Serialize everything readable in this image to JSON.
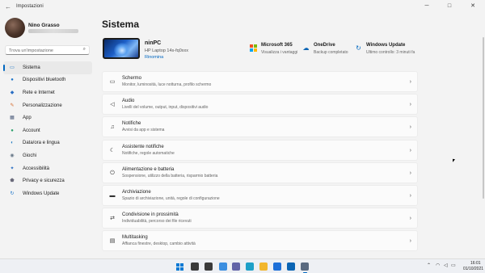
{
  "app": {
    "title": "Impostazioni",
    "back_glyph": "←",
    "minimize_glyph": "─",
    "maximize_glyph": "□",
    "close_glyph": "✕"
  },
  "profile": {
    "name": "Nino Grasso"
  },
  "search": {
    "placeholder": "Trova un'impostazione",
    "icon": "search-icon",
    "glyph": "⌕"
  },
  "sidebar": {
    "items": [
      {
        "label": "Sistema",
        "icon": "monitor-icon",
        "glyph": "▭",
        "color": "#0067c0",
        "active": true
      },
      {
        "label": "Dispositivi bluetooth",
        "icon": "bluetooth-icon",
        "glyph": "●",
        "color": "#1a73c8",
        "active": false
      },
      {
        "label": "Rete e Internet",
        "icon": "network-icon",
        "glyph": "◆",
        "color": "#2a6fc4",
        "active": false
      },
      {
        "label": "Personalizzazione",
        "icon": "brush-icon",
        "glyph": "✎",
        "color": "#d46a2a",
        "active": false
      },
      {
        "label": "App",
        "icon": "apps-icon",
        "glyph": "▦",
        "color": "#4a5a7a",
        "active": false
      },
      {
        "label": "Account",
        "icon": "account-icon",
        "glyph": "●",
        "color": "#2aa06a",
        "active": false
      },
      {
        "label": "Data/ora e lingua",
        "icon": "globe-clock-icon",
        "glyph": "◐",
        "color": "#2a7fc4",
        "active": false
      },
      {
        "label": "Giochi",
        "icon": "gamepad-icon",
        "glyph": "◉",
        "color": "#6a7a8a",
        "active": false
      },
      {
        "label": "Accessibilità",
        "icon": "accessibility-icon",
        "glyph": "✦",
        "color": "#2a6fc4",
        "active": false
      },
      {
        "label": "Privacy e sicurezza",
        "icon": "shield-icon",
        "glyph": "⬟",
        "color": "#6a6a7a",
        "active": false
      },
      {
        "label": "Windows Update",
        "icon": "update-icon",
        "glyph": "↻",
        "color": "#1a73c8",
        "active": false
      }
    ]
  },
  "main": {
    "title": "Sistema",
    "device": {
      "name": "ninPC",
      "model": "HP Laptop 14s-fq0xxx",
      "rename": "Rinomina"
    },
    "quick": [
      {
        "title": "Microsoft 365",
        "sub": "Visualizza i vantaggi",
        "icon": "microsoft-logo-icon"
      },
      {
        "title": "OneDrive",
        "sub": "Backup completato",
        "icon": "cloud-icon",
        "glyph": "☁",
        "color": "#0a64b4"
      },
      {
        "title": "Windows Update",
        "sub": "Ultimo controllo: 3 minuti fa",
        "icon": "update-icon",
        "glyph": "↻",
        "color": "#0067c0"
      }
    ],
    "cards": [
      {
        "title": "Schermo",
        "desc": "Monitor, luminosità, luce notturna, profilo schermo",
        "icon": "display-icon",
        "glyph": "▭"
      },
      {
        "title": "Audio",
        "desc": "Livelli del volume, output, input, dispositivi audio",
        "icon": "speaker-icon",
        "glyph": "◁"
      },
      {
        "title": "Notifiche",
        "desc": "Avvisi da app e sistema",
        "icon": "bell-icon",
        "glyph": "♫"
      },
      {
        "title": "Assistente notifiche",
        "desc": "Notifiche, regole automatiche",
        "icon": "moon-icon",
        "glyph": "☾"
      },
      {
        "title": "Alimentazione e batteria",
        "desc": "Sospensione, utilizzo della batteria, risparmio batteria",
        "icon": "power-icon",
        "glyph": "⏻"
      },
      {
        "title": "Archiviazione",
        "desc": "Spazio di archiviazione, unità, regole di configurazione",
        "icon": "storage-icon",
        "glyph": "▬"
      },
      {
        "title": "Condivisione in prossimità",
        "desc": "Individuabilità, percorso dei file ricevuti",
        "icon": "share-icon",
        "glyph": "⇄"
      },
      {
        "title": "Multitasking",
        "desc": "Affianca finestre, desktop, cambio attività",
        "icon": "multitask-icon",
        "glyph": "▤"
      }
    ],
    "chevron": "›"
  },
  "taskbar": {
    "icons": [
      {
        "name": "start-icon",
        "color": "#0078d4"
      },
      {
        "name": "search-taskbar-icon",
        "color": "#3a3a3a"
      },
      {
        "name": "task-view-icon",
        "color": "#3a3a3a"
      },
      {
        "name": "widgets-icon",
        "color": "#3b8ee0"
      },
      {
        "name": "chat-icon",
        "color": "#6264a7"
      },
      {
        "name": "edge-icon",
        "color": "#1fa0c8"
      },
      {
        "name": "file-explorer-icon",
        "color": "#f2b62d"
      },
      {
        "name": "store-icon",
        "color": "#1d6fd8"
      },
      {
        "name": "mail-icon",
        "color": "#0a64b4"
      },
      {
        "name": "settings-icon",
        "color": "#5a6a80"
      }
    ],
    "time": "16:01",
    "date": "01/10/2021",
    "tray_chevron": "⌃",
    "tray_wifi": "◠",
    "tray_volume": "◁",
    "tray_battery": "▭"
  }
}
